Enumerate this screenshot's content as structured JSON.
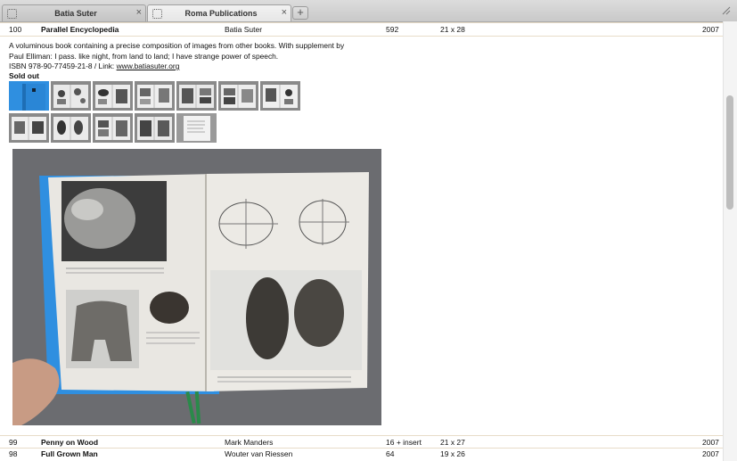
{
  "tabs": [
    {
      "title": "Batia Suter",
      "close": "×",
      "active": false
    },
    {
      "title": "Roma Publications",
      "close": "×",
      "active": true
    }
  ],
  "new_tab_label": "+",
  "rows": {
    "top": {
      "num": "100",
      "title": "Parallel Encyclopedia",
      "author": "Batia Suter",
      "pages": "592",
      "size": "21 x 28",
      "year": "2007"
    },
    "bottom": [
      {
        "num": "99",
        "title": "Penny on Wood",
        "author": "Mark Manders",
        "pages": "16 + insert",
        "size": "21 x 27",
        "year": "2007"
      },
      {
        "num": "98",
        "title": "Full Grown Man",
        "author": "Wouter van Riessen",
        "pages": "64",
        "size": "19 x 26",
        "year": "2007"
      }
    ]
  },
  "description": {
    "line1": "A voluminous book containing a precise composition of images from other books. With supplement by",
    "line2": "Paul Elliman: I pass. like night, from land to land; I have strange power of speech.",
    "isbn": "ISBN 978-90-77459-21-8 / Link: ",
    "link": "www.batiasuter.org",
    "status": "Sold out"
  },
  "colors": {
    "accent_rule": "#e8dcc8",
    "book_cover": "#2f8fe0"
  }
}
